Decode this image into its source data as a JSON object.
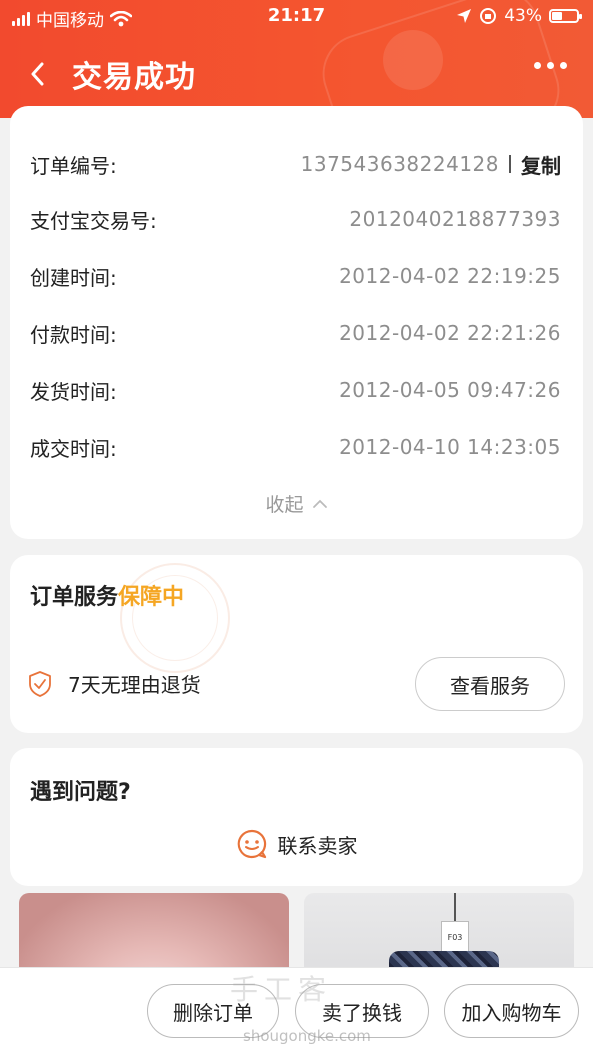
{
  "status_bar": {
    "carrier": "中国移动",
    "time": "21:17",
    "battery_percent": "43%",
    "battery_level": 0.43
  },
  "nav": {
    "back_icon": "chevron-left-icon",
    "title": "交易成功",
    "more_icon": "more-dots-icon"
  },
  "order_details": {
    "rows": [
      {
        "label": "订单编号:",
        "value": "137543638224128"
      },
      {
        "label": "支付宝交易号:",
        "value": "2012040218877393"
      },
      {
        "label": "创建时间:",
        "value": "2012-04-02 22:19:25"
      },
      {
        "label": "付款时间:",
        "value": "2012-04-02 22:21:26"
      },
      {
        "label": "发货时间:",
        "value": "2012-04-05 09:47:26"
      },
      {
        "label": "成交时间:",
        "value": "2012-04-10 14:23:05"
      }
    ],
    "copy_separator": "|",
    "copy_label": "复制",
    "collapse_label": "收起"
  },
  "service": {
    "title": "订单服务",
    "highlight": "保障中",
    "highlight_color": "#f5a623",
    "item_label": "7天无理由退货",
    "view_button": "查看服务"
  },
  "help": {
    "title": "遇到问题?",
    "contact_label": "联系卖家"
  },
  "bottom_bar": {
    "delete_label": "删除订单",
    "sell_label": "卖了换钱",
    "cart_label": "加入购物车"
  },
  "product_tag": "F03",
  "watermark": {
    "main": "手工客",
    "sub": "shougongke.com"
  },
  "colors": {
    "header": "#f24a2e",
    "accent": "#f5a623",
    "icon_orange": "#e8733a"
  }
}
